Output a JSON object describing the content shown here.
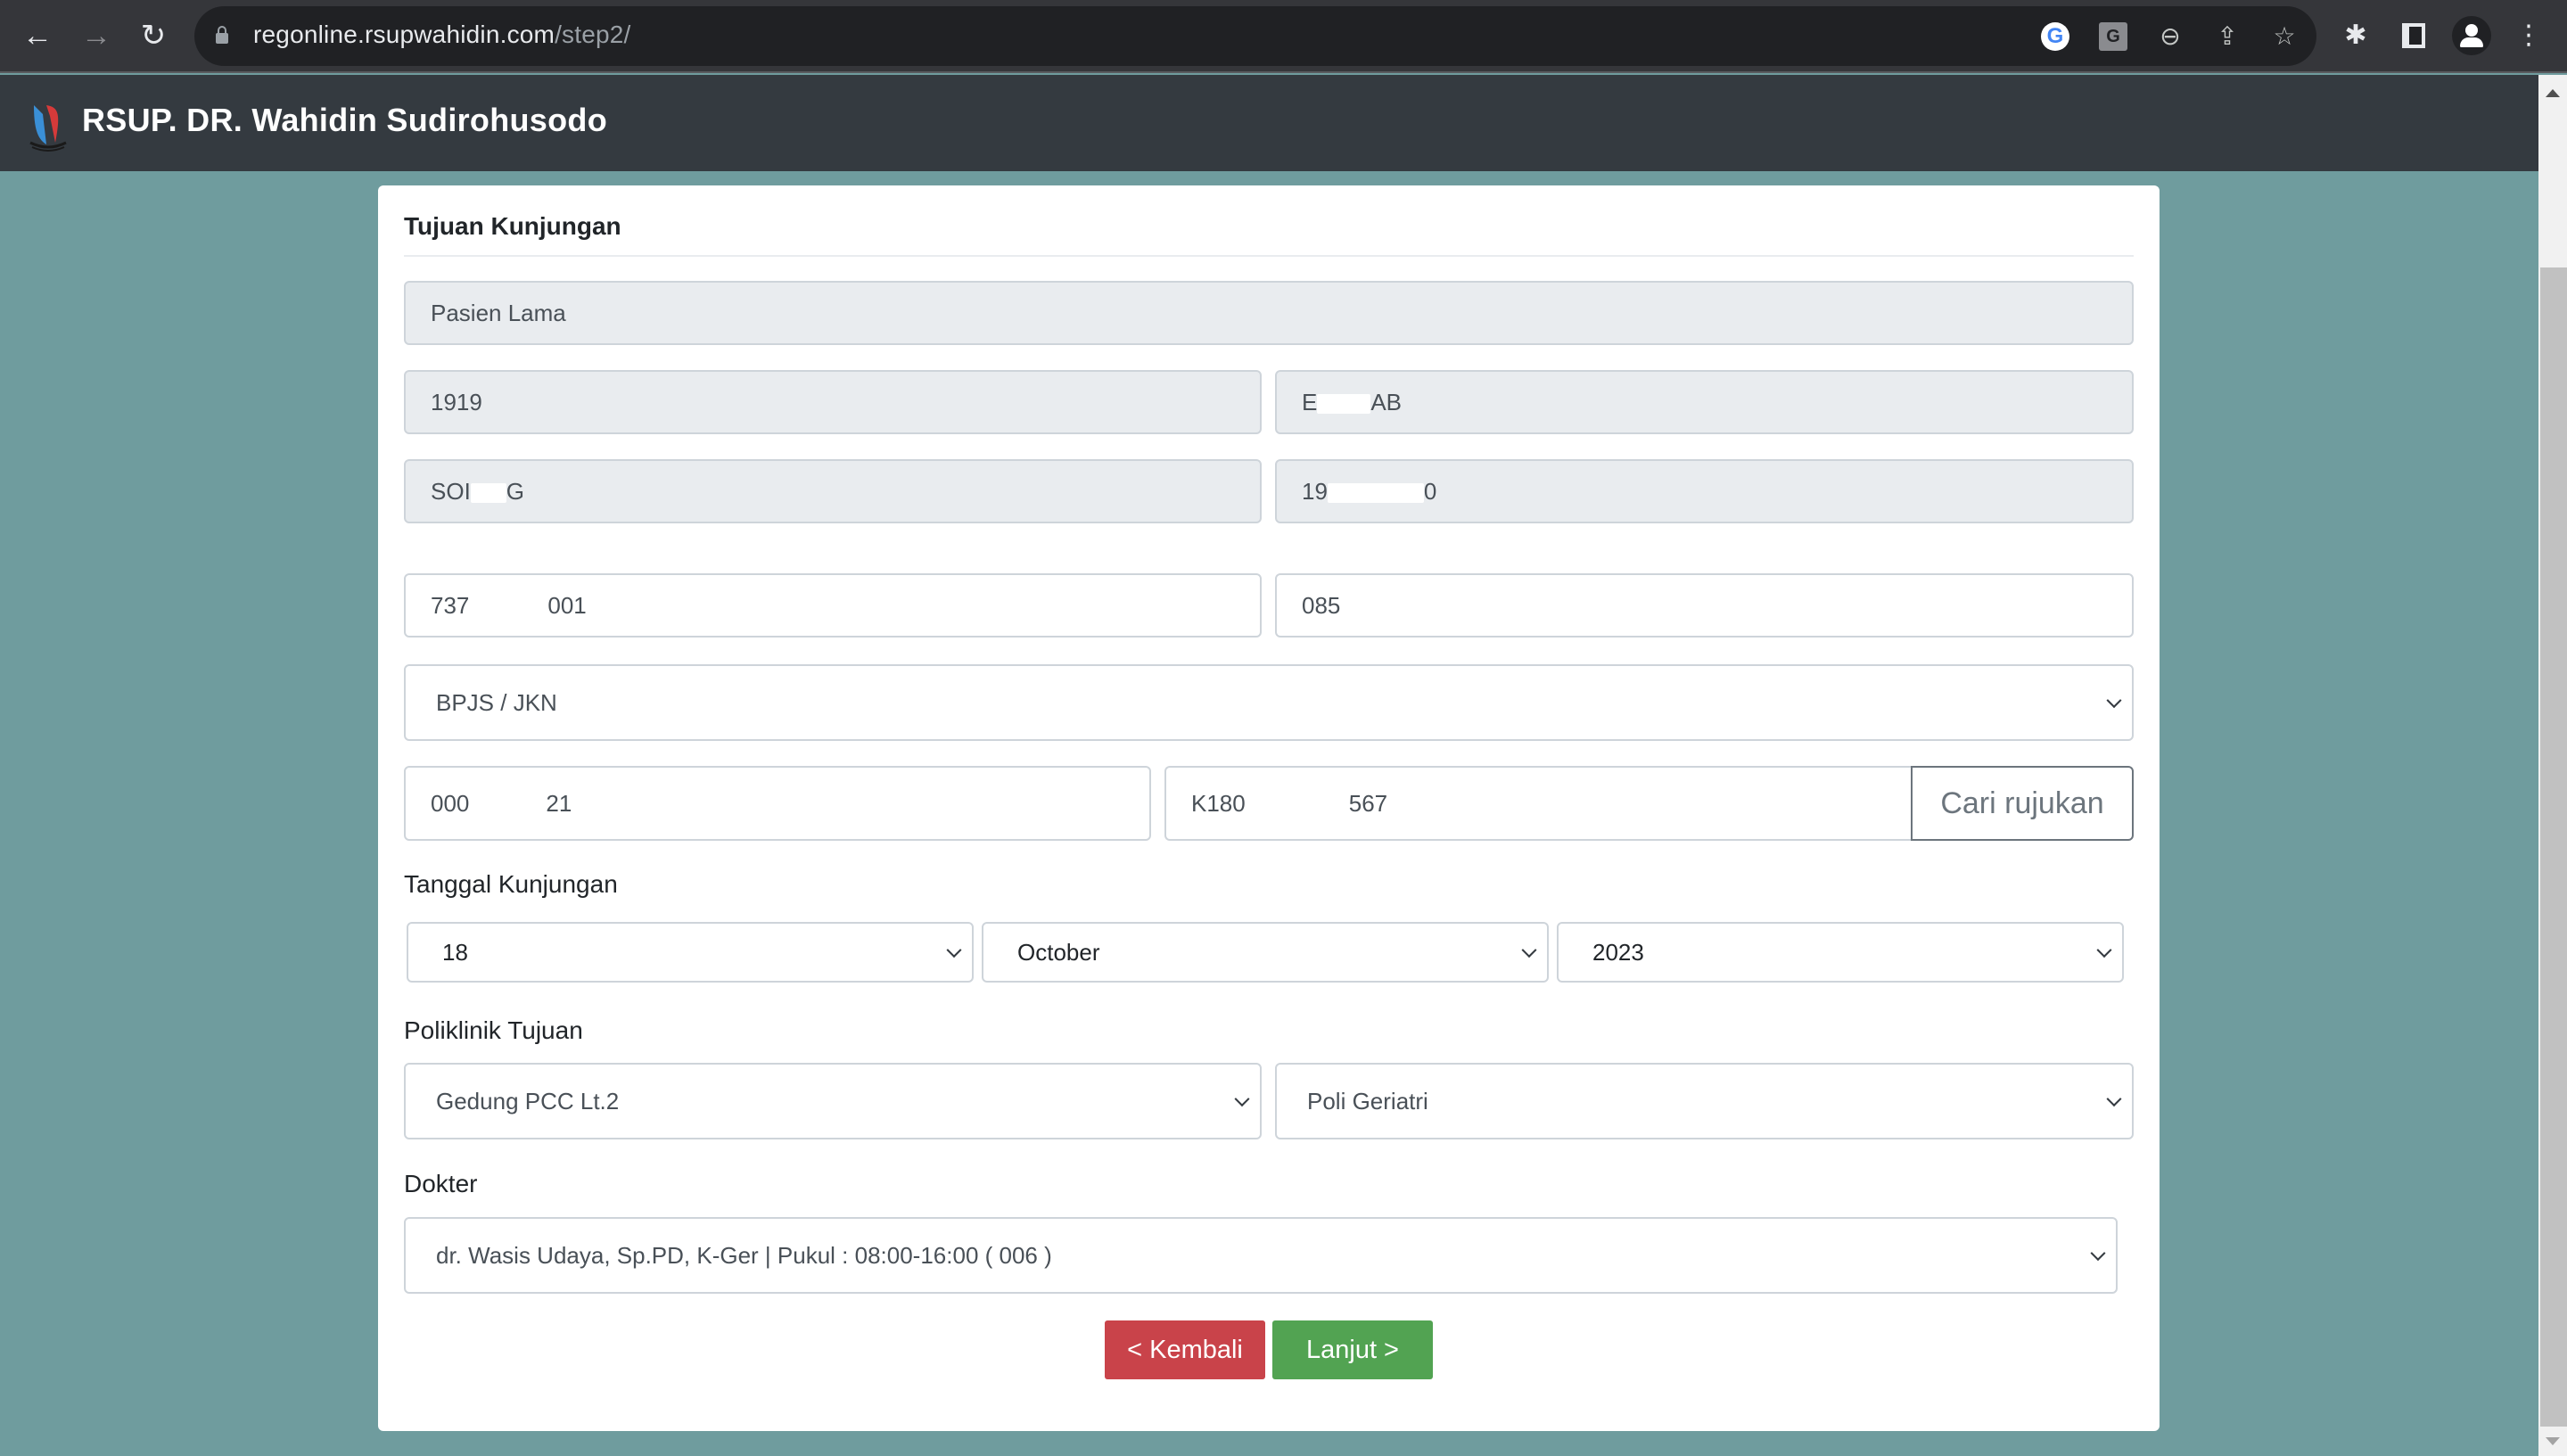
{
  "browser": {
    "url_host": "regonline.rsupwahidin.com",
    "url_path": "/step2/",
    "icons": [
      "back-icon",
      "forward-icon",
      "reload-icon",
      "lock-icon",
      "google-icon",
      "translate-icon",
      "zoom-out-icon",
      "share-icon",
      "bookmark-star-icon",
      "extensions-icon",
      "side-panel-icon",
      "profile-icon",
      "menu-icon"
    ],
    "glyphs": {
      "back": "←",
      "forward": "→",
      "reload": "↻",
      "google": "G",
      "translate": "G",
      "zoom": "⊖",
      "share": "⇪",
      "star": "☆",
      "puzzle": "✱",
      "menu": "⋮"
    }
  },
  "header": {
    "site_title": "RSUP. DR. Wahidin Sudirohusodo"
  },
  "form": {
    "title": "Tujuan Kunjungan",
    "patient_type": "Pasien Lama",
    "rm_number": "1919",
    "name_visible": {
      "prefix": "E",
      "suffix": "AB"
    },
    "birthplace_visible": {
      "prefix": "SOI",
      "suffix": "G"
    },
    "birthdate_visible": {
      "prefix": "19",
      "suffix": "0"
    },
    "nik_visible": {
      "prefix": "737",
      "suffix": "001"
    },
    "phone_visible": {
      "prefix": "085",
      "suffix": ""
    },
    "payment_method": "BPJS / JKN",
    "bpjs_card_visible": {
      "prefix": "000",
      "suffix": "21"
    },
    "referral_visible": {
      "prefix": "K180",
      "suffix": "567"
    },
    "find_referral_label": "Cari rujukan",
    "visit_date_label": "Tanggal Kunjungan",
    "visit_day": "18",
    "visit_month": "October",
    "visit_year": "2023",
    "clinic_label": "Poliklinik Tujuan",
    "building": "Gedung PCC Lt.2",
    "clinic": "Poli Geriatri",
    "doctor_label": "Dokter",
    "doctor": "dr. Wasis Udaya, Sp.PD, K-Ger | Pukul : 08:00-16:00 ( 006 )",
    "back_label": "< Kembali",
    "next_label": "Lanjut >"
  },
  "colors": {
    "page_bg": "#6f9c9e",
    "header_bg": "#343a40",
    "back_button": "#c9434a",
    "next_button": "#52a352"
  }
}
